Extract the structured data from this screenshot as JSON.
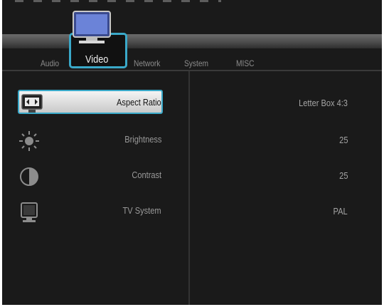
{
  "tabs": [
    {
      "label": "Audio"
    },
    {
      "label": "Video"
    },
    {
      "label": "Network"
    },
    {
      "label": "System"
    },
    {
      "label": "MISC"
    }
  ],
  "active_tab": "Video",
  "settings": [
    {
      "label": "Aspect Ratio",
      "value": "Letter Box 4:3",
      "icon": "aspect-ratio-icon"
    },
    {
      "label": "Brightness",
      "value": "25",
      "icon": "sun-icon"
    },
    {
      "label": "Contrast",
      "value": "25",
      "icon": "contrast-icon"
    },
    {
      "label": "TV System",
      "value": "PAL",
      "icon": "monitor-icon"
    }
  ],
  "selected_setting": "Aspect Ratio",
  "colors": {
    "background": "#1a1a1a",
    "highlight_border": "#3aa9c9",
    "text_dim": "#9a9a9a"
  }
}
